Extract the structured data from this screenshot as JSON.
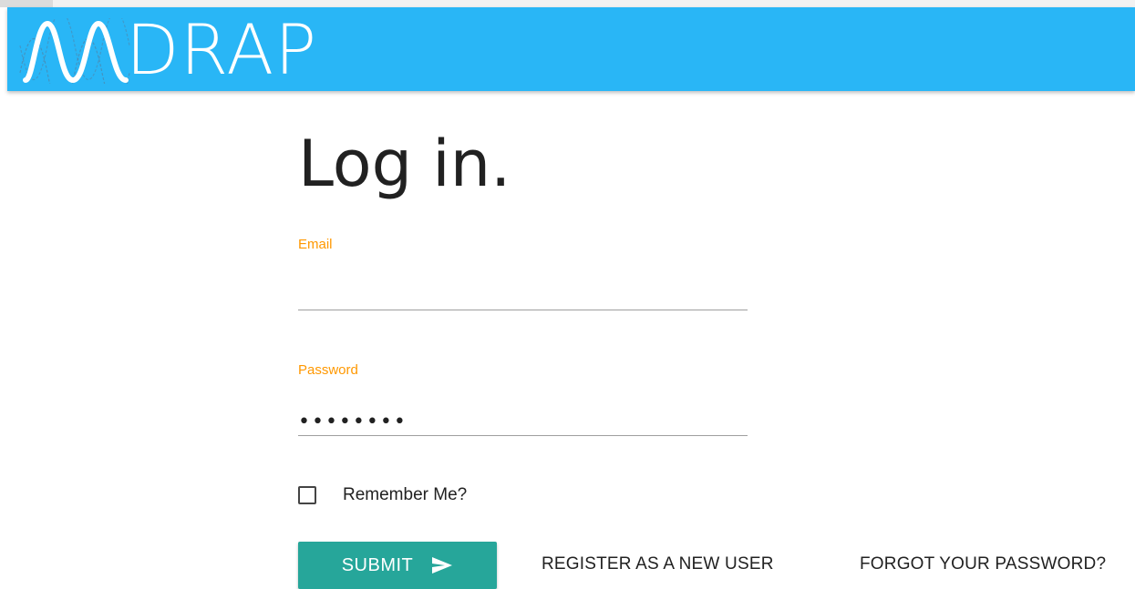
{
  "header": {
    "logo_text": "DRAP",
    "logo_icon": "wave-logo-icon",
    "background_color": "#29b6f6"
  },
  "page": {
    "title": "Log in."
  },
  "form": {
    "email_label": "Email",
    "email_value": "",
    "password_label": "Password",
    "password_value": "••••••••",
    "remember_label": "Remember Me?",
    "remember_checked": false,
    "label_color": "#ff9800"
  },
  "actions": {
    "submit_label": "SUBMIT",
    "submit_icon": "send-icon",
    "submit_color": "#26a69a",
    "register_label": "REGISTER AS A NEW USER",
    "forgot_label": "FORGOT YOUR PASSWORD?"
  }
}
